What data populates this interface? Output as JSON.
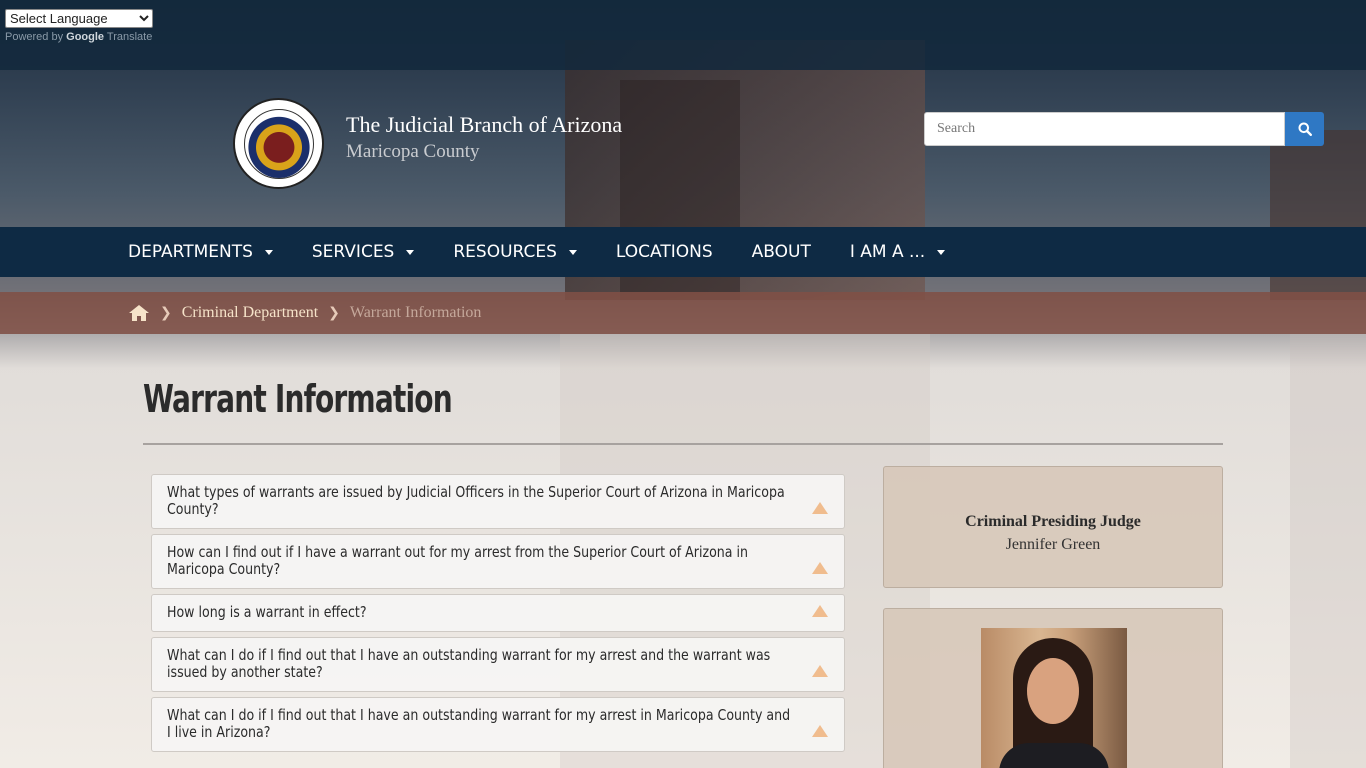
{
  "translate": {
    "select_label": "Select Language",
    "powered_by": "Powered by",
    "google": "Google",
    "translate": "Translate"
  },
  "header": {
    "title": "The Judicial Branch of Arizona",
    "subtitle": "Maricopa County",
    "search_placeholder": "Search"
  },
  "nav": {
    "items": [
      {
        "label": "DEPARTMENTS",
        "dropdown": true
      },
      {
        "label": "SERVICES",
        "dropdown": true
      },
      {
        "label": "RESOURCES",
        "dropdown": true
      },
      {
        "label": "LOCATIONS",
        "dropdown": false
      },
      {
        "label": "ABOUT",
        "dropdown": false
      },
      {
        "label": "I AM A ...",
        "dropdown": true
      }
    ]
  },
  "breadcrumb": {
    "parent": "Criminal Department",
    "current": "Warrant Information"
  },
  "main": {
    "title": "Warrant Information",
    "faq": [
      "What types of warrants are issued by Judicial Officers in the Superior Court of Arizona in Maricopa County?",
      "How can I find out if I have a warrant out for my arrest from the Superior Court of Arizona in Maricopa County?",
      "How long is a warrant in effect?",
      "What can I do if I find out that I have an outstanding warrant for my arrest and the warrant was issued by another state?",
      "What can I do if I find out that I have an outstanding warrant for my arrest in Maricopa County and I live in Arizona?"
    ]
  },
  "sidebar": {
    "judge_title": "Criminal Presiding Judge",
    "judge_name": "Jennifer Green"
  },
  "colors": {
    "nav_bg": "#0e2a44",
    "breadcrumb_bg": "#805046",
    "search_button": "#2f78c4",
    "faq_arrow": "#f0bc8e"
  }
}
